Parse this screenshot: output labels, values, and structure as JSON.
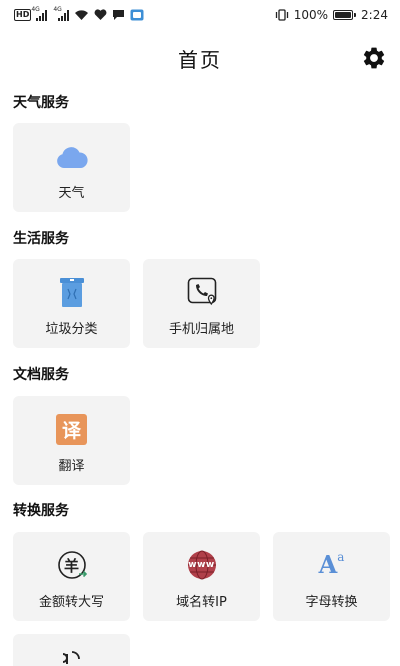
{
  "status_bar": {
    "hd": "HD",
    "net1": "4G",
    "net2": "4G",
    "battery_pct": "100%",
    "time": "2:24"
  },
  "header": {
    "title": "首页"
  },
  "sections": [
    {
      "title": "天气服务",
      "items": [
        {
          "label": "天气",
          "icon": "cloud-icon"
        }
      ]
    },
    {
      "title": "生活服务",
      "items": [
        {
          "label": "垃圾分类",
          "icon": "trash-bin-icon"
        },
        {
          "label": "手机归属地",
          "icon": "phone-location-icon"
        }
      ]
    },
    {
      "title": "文档服务",
      "items": [
        {
          "label": "翻译",
          "icon": "translate-icon",
          "icon_text": "译"
        }
      ]
    },
    {
      "title": "转换服务",
      "items": [
        {
          "label": "金额转大写",
          "icon": "currency-convert-icon",
          "icon_text": "羊"
        },
        {
          "label": "域名转IP",
          "icon": "www-globe-icon",
          "icon_text": "www"
        },
        {
          "label": "字母转换",
          "icon": "letter-case-icon",
          "icon_text": "A",
          "icon_text2": "a"
        }
      ]
    }
  ],
  "colors": {
    "cloud": "#7aa7ee",
    "translate_bg": "#e8955a",
    "trash": "#4a8fd6",
    "www_globe": "#b0404a",
    "letter": "#5a8fd6",
    "tile_bg": "#f3f3f3"
  }
}
